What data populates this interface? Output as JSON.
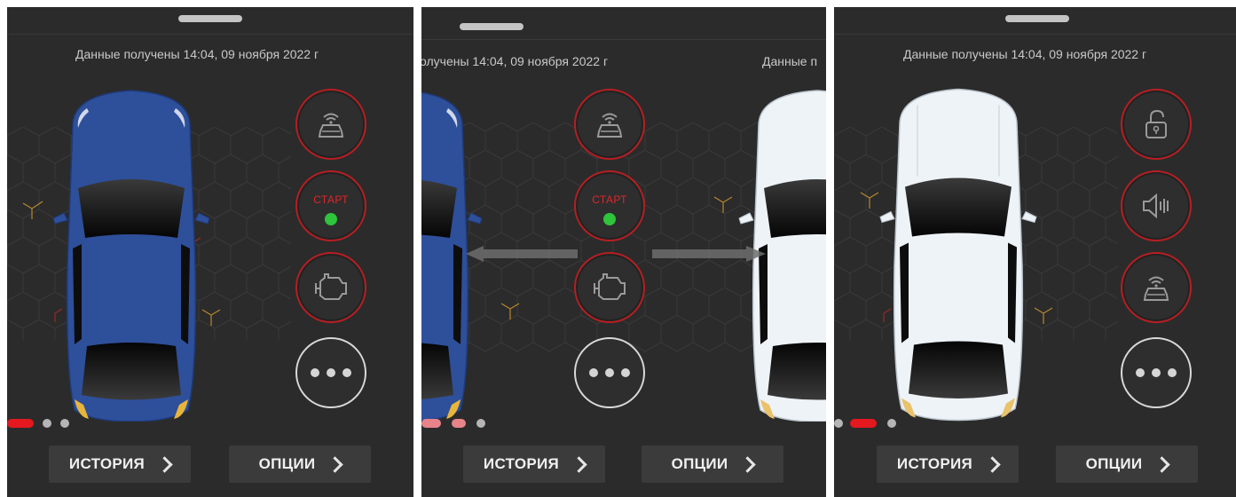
{
  "colors": {
    "accent_red": "#b81e22",
    "start_text": "#e0262b",
    "indicator_green": "#2ec43b",
    "car_blue": "#2e4f9a",
    "car_white": "#eef3f8",
    "bg": "#2b2b2b"
  },
  "panels": [
    {
      "data_line": "Данные получены 14:04, 09 ноября 2022 г",
      "buttons": [
        {
          "icon": "car-remote-icon"
        },
        {
          "label": "СТАРТ",
          "status": "running"
        },
        {
          "icon": "engine-icon"
        },
        {
          "icon": "more-icon"
        }
      ],
      "history_label": "ИСТОРИЯ",
      "options_label": "ОПЦИИ",
      "page_indicator": {
        "pages": 3,
        "active": 1
      }
    },
    {
      "data_line_left": "олучены 14:04, 09 ноября 2022 г",
      "data_line_right": "Данные п",
      "buttons": [
        {
          "icon": "car-remote-icon"
        },
        {
          "label": "СТАРТ",
          "status": "running"
        },
        {
          "icon": "engine-icon"
        },
        {
          "icon": "more-icon"
        }
      ],
      "history_label": "ИСТОРИЯ",
      "options_label": "ОПЦИИ",
      "swipe_hint": [
        "arrow-left-icon",
        "arrow-right-icon"
      ]
    },
    {
      "data_line": "Данные получены 14:04, 09 ноября 2022 г",
      "buttons": [
        {
          "icon": "unlock-icon"
        },
        {
          "icon": "speaker-icon"
        },
        {
          "icon": "car-remote-icon"
        },
        {
          "icon": "more-icon"
        }
      ],
      "history_label": "ИСТОРИЯ",
      "options_label": "ОПЦИИ",
      "page_indicator": {
        "pages": 3,
        "active": 2
      }
    }
  ]
}
